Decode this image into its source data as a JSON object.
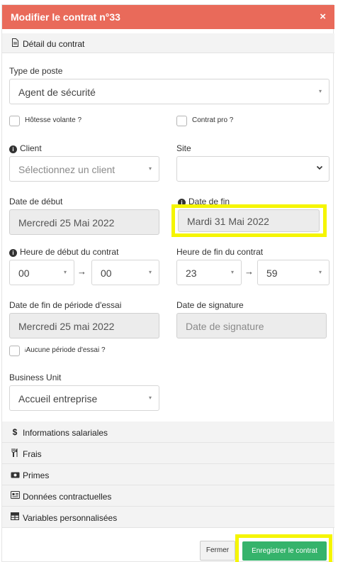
{
  "header": {
    "title": "Modifier le contrat n°33",
    "close": "×"
  },
  "detail_section": {
    "label": "Détail du contrat"
  },
  "type_poste": {
    "label": "Type de poste",
    "value": "Agent de sécurité"
  },
  "hotesse_volante": {
    "label": "Hôtesse volante ?"
  },
  "contrat_pro": {
    "label": "Contrat pro ?"
  },
  "client": {
    "label": "Client",
    "placeholder": "Sélectionnez un client"
  },
  "site": {
    "label": "Site",
    "value": ""
  },
  "date_debut": {
    "label": "Date de début",
    "value": "Mercredi 25 Mai 2022"
  },
  "date_fin": {
    "label": "Date de fin",
    "value": "Mardi 31 Mai 2022"
  },
  "heure_debut": {
    "label": "Heure de début du contrat",
    "hour": "00",
    "minute": "00"
  },
  "heure_fin": {
    "label": "Heure de fin du contrat",
    "hour": "23",
    "minute": "59"
  },
  "fin_essai": {
    "label": "Date de fin de période d'essai",
    "value": "Mercredi 25 mai 2022"
  },
  "date_signature": {
    "label": "Date de signature",
    "placeholder": "Date de signature"
  },
  "aucune_essai": {
    "label": "Aucune période d'essai ?"
  },
  "business_unit": {
    "label": "Business Unit",
    "value": "Accueil entreprise"
  },
  "sections": [
    {
      "label": "Informations salariales",
      "icon": "dollar-icon"
    },
    {
      "label": "Frais",
      "icon": "utensils-icon"
    },
    {
      "label": "Primes",
      "icon": "money-bill-icon"
    },
    {
      "label": "Données contractuelles",
      "icon": "id-card-icon"
    },
    {
      "label": "Variables personnalisées",
      "icon": "table-icon"
    }
  ],
  "footer": {
    "close_label": "Fermer",
    "save_label": "Enregistrer le contrat"
  },
  "colors": {
    "header": "#e96a5a",
    "save_button": "#35b36b",
    "highlight": "#f5f500"
  }
}
